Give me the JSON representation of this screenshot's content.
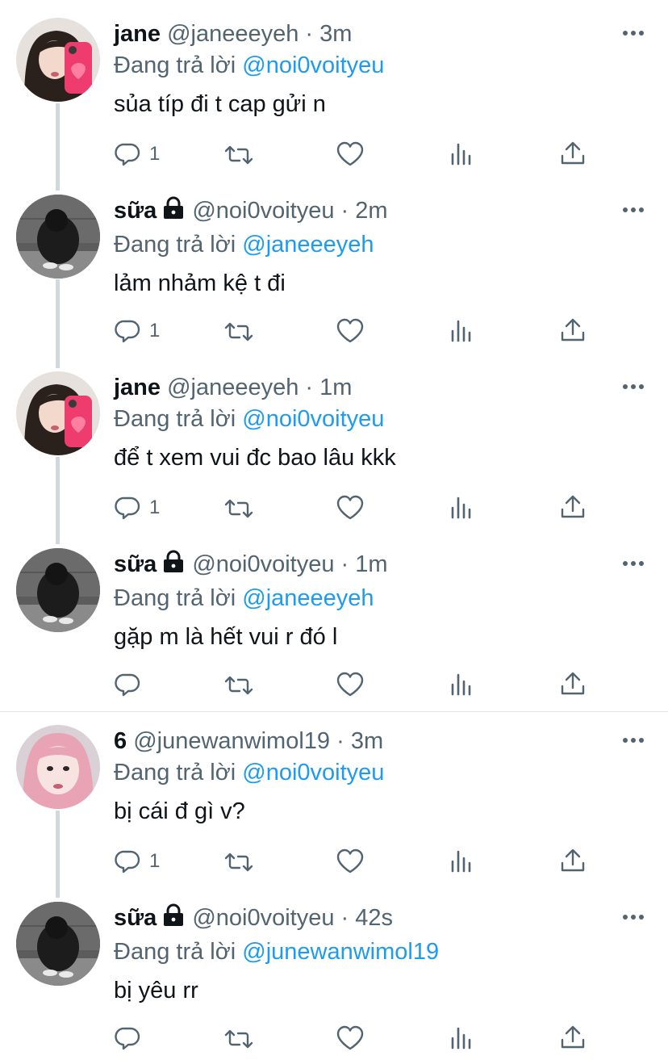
{
  "reply_prefix": "Đang trả lời",
  "tweets": [
    {
      "name": "jane",
      "handle": "@janeeeyeh",
      "time": "3m",
      "reply_to": "@noi0voityeu",
      "text": "sủa típ đi t cap gửi n",
      "reply_count": "1",
      "avatar": "jane",
      "locked": false
    },
    {
      "name": "sữa",
      "handle": "@noi0voityeu",
      "time": "2m",
      "reply_to": "@janeeeyeh",
      "text": "lảm nhảm kệ t đi",
      "reply_count": "1",
      "avatar": "sua",
      "locked": true
    },
    {
      "name": "jane",
      "handle": "@janeeeyeh",
      "time": "1m",
      "reply_to": "@noi0voityeu",
      "text": "để t xem vui đc bao lâu kkk",
      "reply_count": "1",
      "avatar": "jane",
      "locked": false
    },
    {
      "name": "sữa",
      "handle": "@noi0voityeu",
      "time": "1m",
      "reply_to": "@janeeeyeh",
      "text": "gặp m là hết vui r đó l",
      "reply_count": "",
      "avatar": "sua",
      "locked": true
    },
    {
      "name": "6",
      "handle": "@junewanwimol19",
      "time": "3m",
      "reply_to": "@noi0voityeu",
      "text": "bị cái đ gì v?",
      "reply_count": "1",
      "avatar": "june",
      "locked": false
    },
    {
      "name": "sữa",
      "handle": "@noi0voityeu",
      "time": "42s",
      "reply_to": "@junewanwimol19",
      "text": "bị yêu rr",
      "reply_count": "",
      "avatar": "sua",
      "locked": true
    }
  ],
  "icons": {
    "reply": "reply-icon",
    "retweet": "retweet-icon",
    "like": "heart-icon",
    "views": "views-icon",
    "share": "share-icon",
    "more": "more-icon",
    "lock": "lock-icon"
  },
  "colors": {
    "mention": "#1d9bf0",
    "secondary": "#536471",
    "text": "#0f1419",
    "thread_line": "#cfd9de"
  }
}
